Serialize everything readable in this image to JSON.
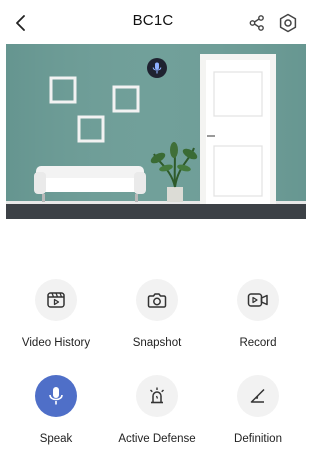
{
  "header": {
    "title": "BC1C"
  },
  "controls": [
    {
      "label": "Video History",
      "icon": "video-history-icon"
    },
    {
      "label": "Snapshot",
      "icon": "camera-icon"
    },
    {
      "label": "Record",
      "icon": "record-icon"
    },
    {
      "label": "Speak",
      "icon": "microphone-icon",
      "active": true
    },
    {
      "label": "Active Defense",
      "icon": "alarm-light-icon"
    },
    {
      "label": "Definition",
      "icon": "definition-icon"
    }
  ],
  "colors": {
    "accent": "#4f6fc8",
    "button_bg": "#f2f2f2"
  }
}
